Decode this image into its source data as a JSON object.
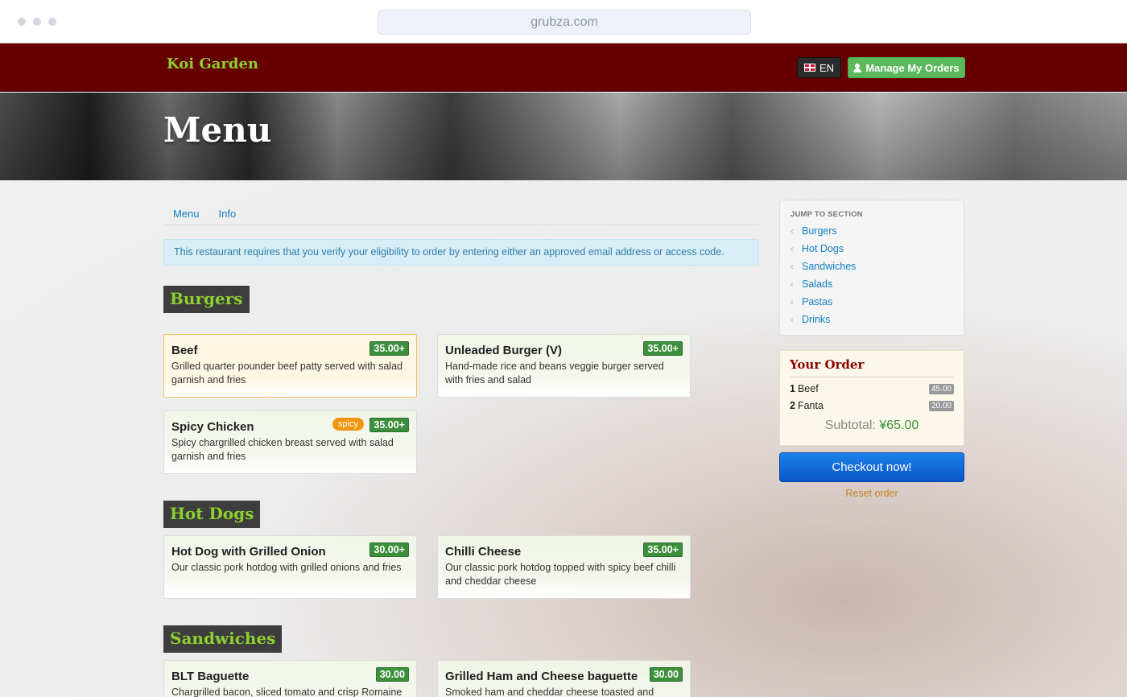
{
  "browser": {
    "url": "grubza.com"
  },
  "header": {
    "brand": "Koi Garden",
    "lang_label": "EN",
    "manage_label": "Manage My Orders"
  },
  "hero": {
    "title": "Menu"
  },
  "tabs": [
    {
      "label": "Menu"
    },
    {
      "label": "Info"
    }
  ],
  "alert": "This restaurant requires that you verify your eligibility to order by entering either an approved email address or access code.",
  "sections": [
    {
      "title": "Burgers",
      "items": [
        {
          "name": "Beef",
          "price": "35.00+",
          "desc": "Grilled quarter pounder beef patty served with salad garnish and fries"
        },
        {
          "name": "Unleaded Burger (V)",
          "price": "35.00+",
          "desc": "Hand-made rice and beans veggie burger served with fries and salad"
        },
        {
          "name": "Spicy Chicken",
          "price": "35.00+",
          "badge": "spicy",
          "desc": "Spicy chargrilled chicken breast served with salad garnish and fries"
        }
      ]
    },
    {
      "title": "Hot Dogs",
      "items": [
        {
          "name": "Hot Dog with Grilled Onion",
          "price": "30.00+",
          "desc": "Our classic pork hotdog with grilled onions and fries"
        },
        {
          "name": "Chilli Cheese",
          "price": "35.00+",
          "desc": "Our classic pork hotdog topped with spicy beef chilli and cheddar cheese"
        }
      ]
    },
    {
      "title": "Sandwiches",
      "items": [
        {
          "name": "BLT Baguette",
          "price": "30.00",
          "desc": "Chargrilled bacon, sliced tomato and crisp Romaine"
        },
        {
          "name": "Grilled Ham and Cheese baguette",
          "price": "30.00",
          "desc": "Smoked ham and cheddar cheese toasted and served"
        }
      ]
    }
  ],
  "sidebar": {
    "jump_heading": "JUMP TO SECTION",
    "links": [
      "Burgers",
      "Hot Dogs",
      "Sandwiches",
      "Salads",
      "Pastas",
      "Drinks"
    ]
  },
  "order": {
    "title": "Your Order",
    "items": [
      {
        "qty": "1",
        "name": "Beef",
        "price": "45.00"
      },
      {
        "qty": "2",
        "name": "Fanta",
        "price": "20.00"
      }
    ],
    "subtotal_label": "Subtotal:",
    "subtotal_value": "¥65.00",
    "checkout_label": "Checkout now!",
    "reset_label": "Reset order"
  }
}
